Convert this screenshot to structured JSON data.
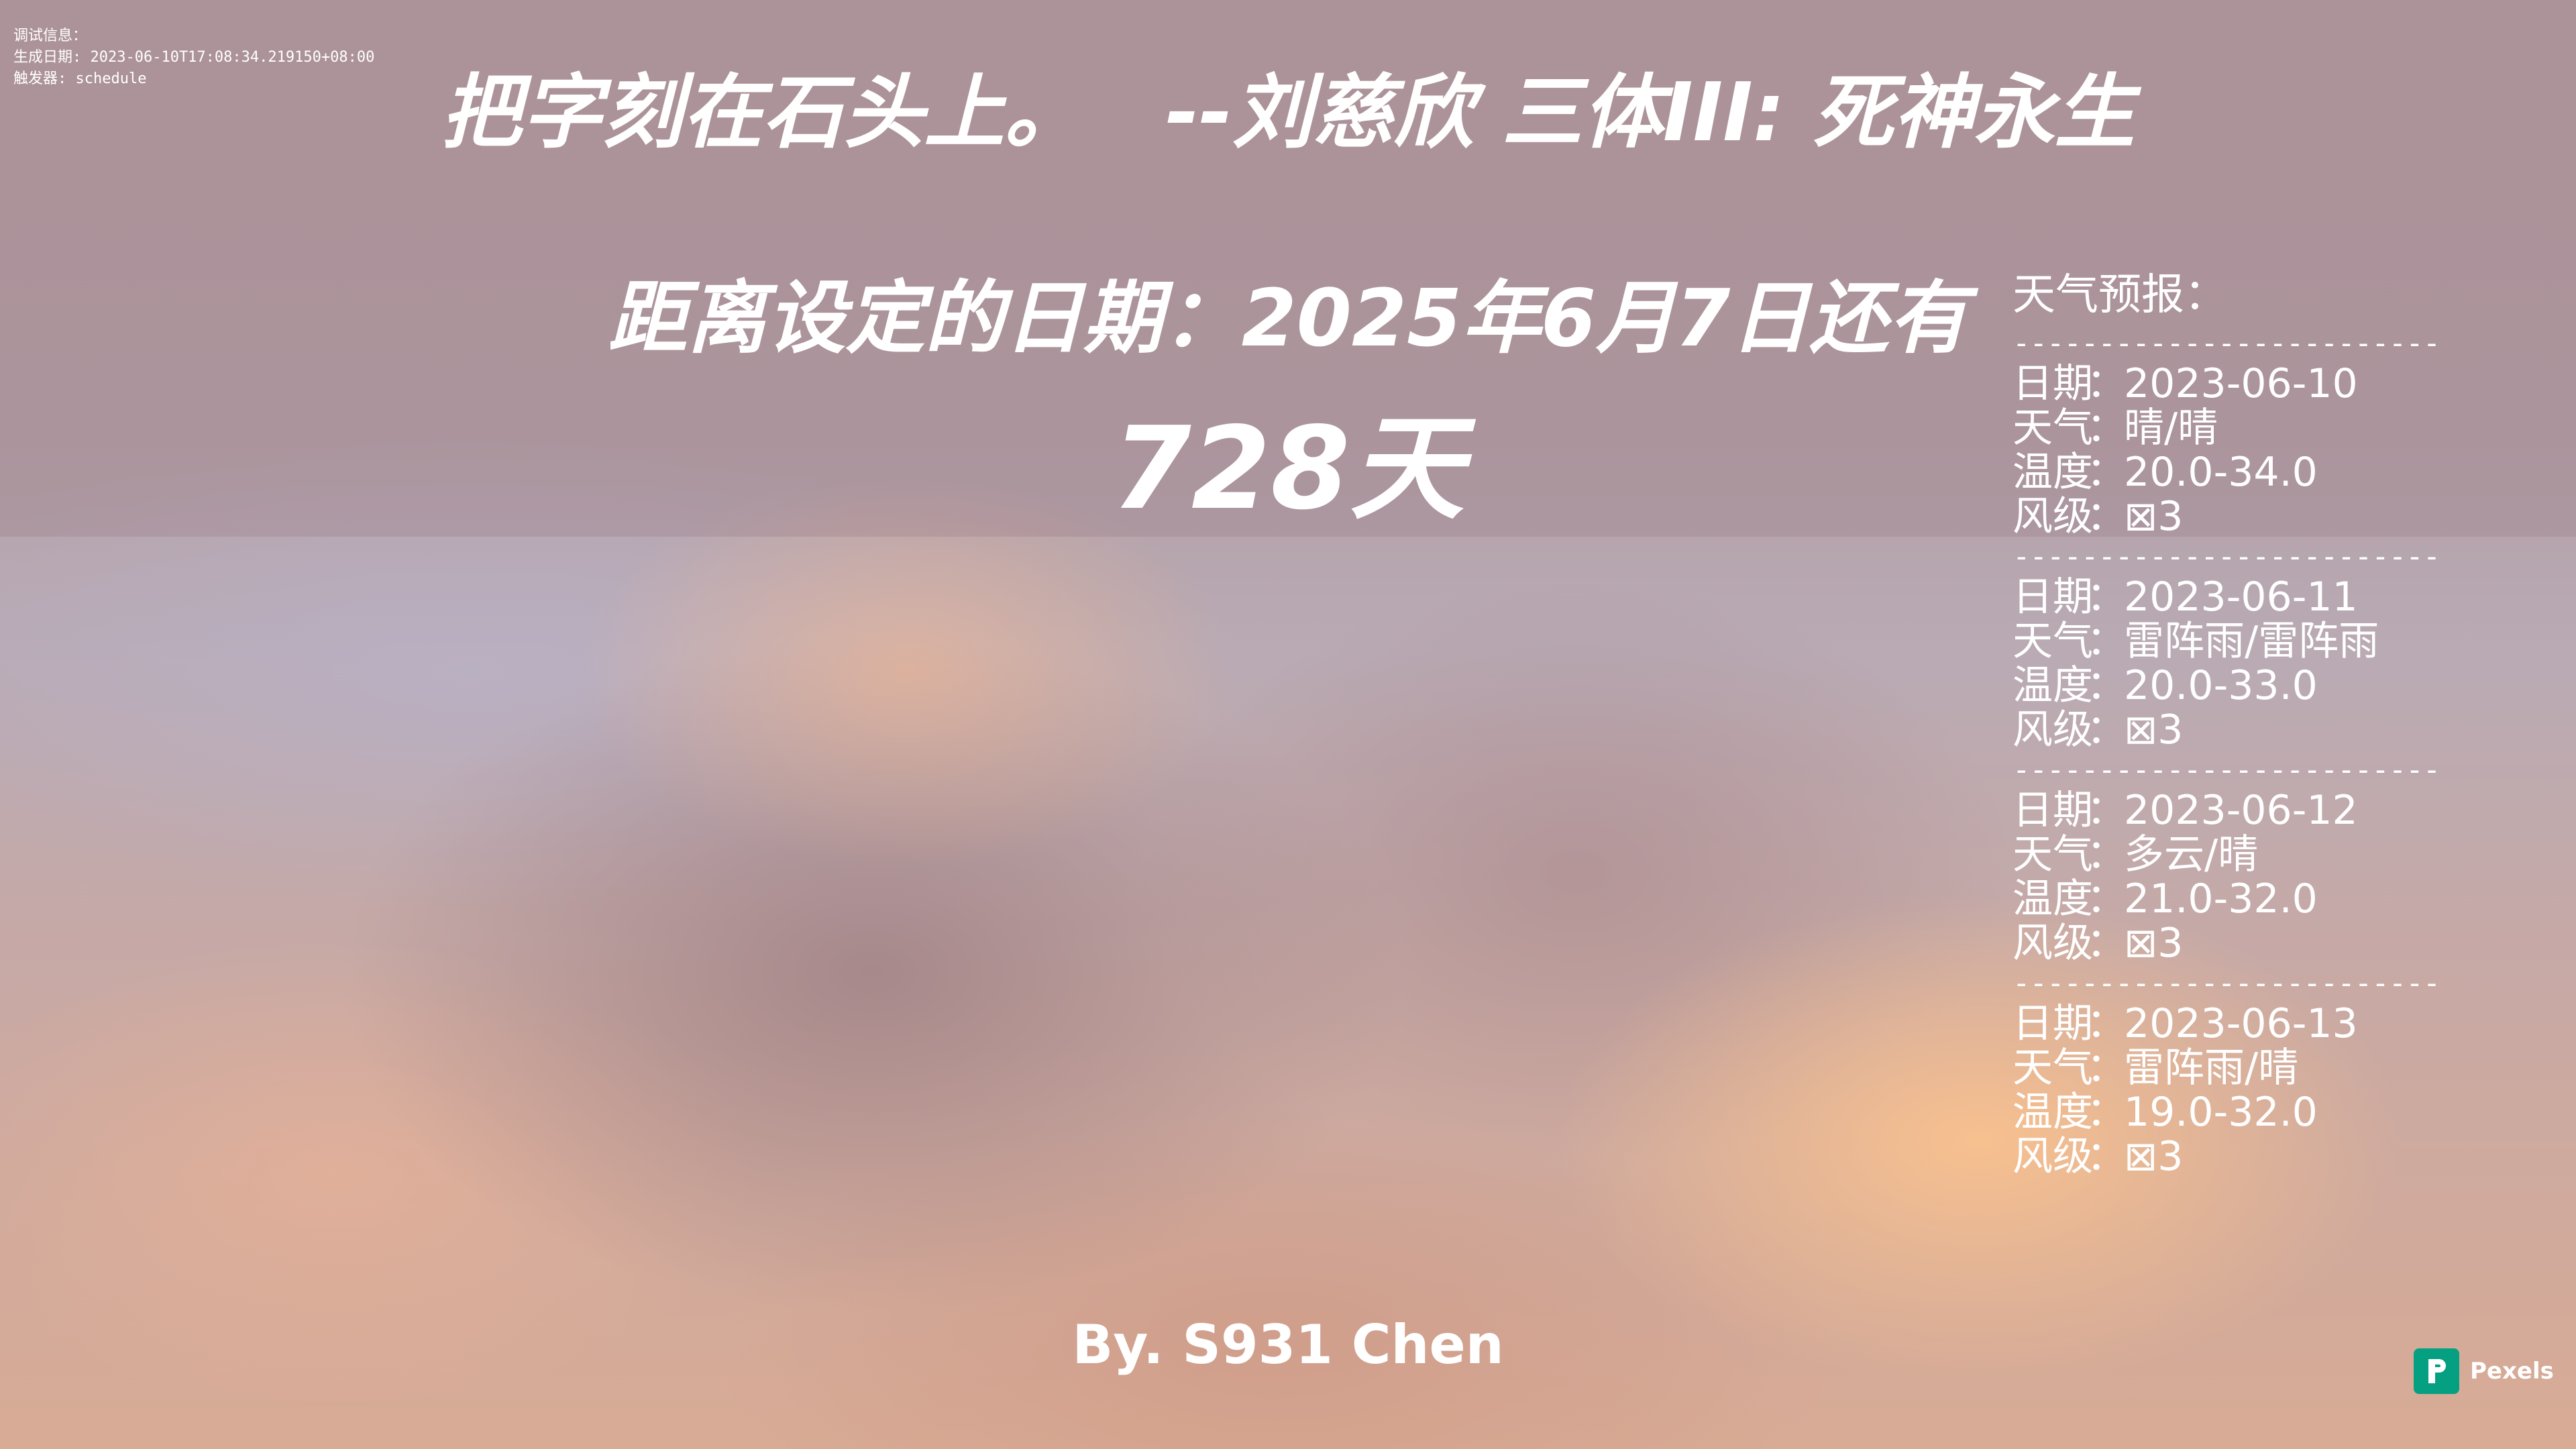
{
  "debug": {
    "title": "调试信息：",
    "generated": "生成日期: 2023-06-10T17:08:34.219150+08:00",
    "trigger": "触发器: schedule"
  },
  "quote": {
    "text": "把字刻在石头上。",
    "attribution": "--刘慈欣 三体III: 死神永生"
  },
  "countdown": {
    "label": "距离设定的日期：2025年6月7日还有",
    "value": "728天"
  },
  "weather": {
    "heading": "天气预报：",
    "separator": "--------------------------------",
    "labels": {
      "date": "日期",
      "weather": "天气",
      "temperature": "温度",
      "wind": "风级",
      "colon": "："
    },
    "days": [
      {
        "date": "2023-06-10",
        "weather": "晴/晴",
        "temperature": "20.0-34.0",
        "wind": "⊠3"
      },
      {
        "date": "2023-06-11",
        "weather": "雷阵雨/雷阵雨",
        "temperature": "20.0-33.0",
        "wind": "⊠3"
      },
      {
        "date": "2023-06-12",
        "weather": "多云/晴",
        "temperature": "21.0-32.0",
        "wind": "⊠3"
      },
      {
        "date": "2023-06-13",
        "weather": "雷阵雨/晴",
        "temperature": "19.0-32.0",
        "wind": "⊠3"
      }
    ]
  },
  "byline": "By. S931 Chen",
  "watermark": {
    "label": "Pexels",
    "icon": "pexels-logo-icon",
    "color": "#05a081"
  }
}
